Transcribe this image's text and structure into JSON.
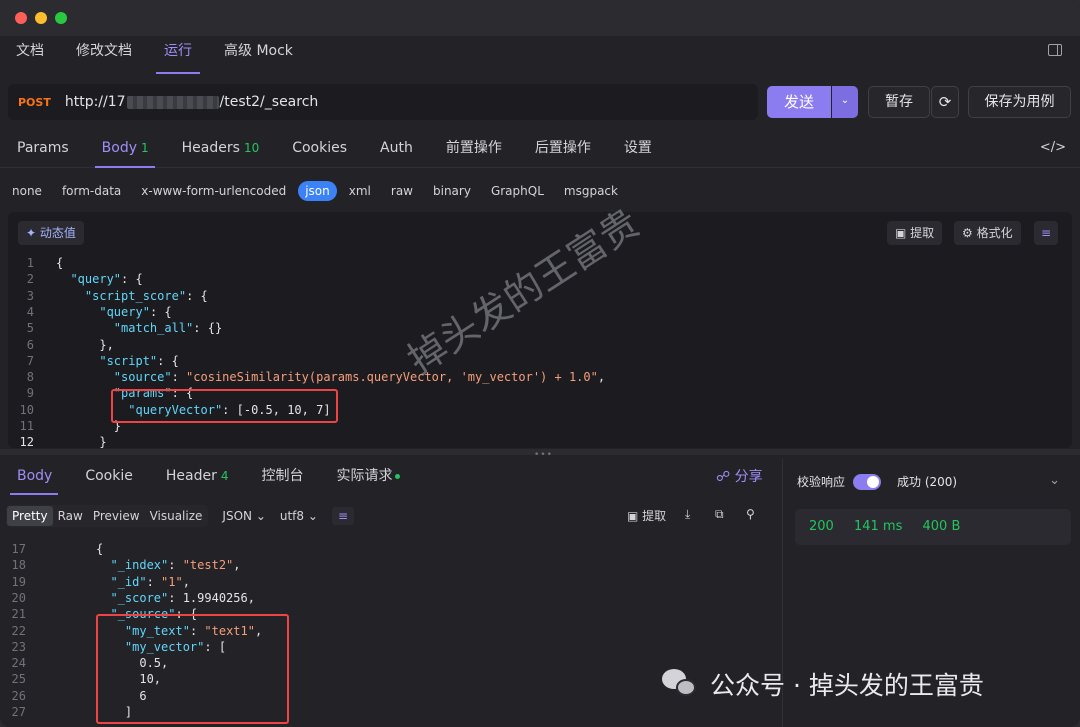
{
  "top_tabs": [
    {
      "label": "文档"
    },
    {
      "label": "修改文档"
    },
    {
      "label": "运行"
    },
    {
      "label": "高级 Mock"
    }
  ],
  "request": {
    "method": "POST",
    "url_prefix": "http://17",
    "url_suffix": "/test2/_search",
    "send_label": "发送",
    "save_temp_label": "暂存",
    "save_case_label": "保存为用例"
  },
  "request_tabs": [
    {
      "label": "Params",
      "count": ""
    },
    {
      "label": "Body",
      "count": "1"
    },
    {
      "label": "Headers",
      "count": "10"
    },
    {
      "label": "Cookies",
      "count": ""
    },
    {
      "label": "Auth",
      "count": ""
    },
    {
      "label": "前置操作",
      "count": ""
    },
    {
      "label": "后置操作",
      "count": ""
    },
    {
      "label": "设置",
      "count": ""
    }
  ],
  "code_toggle_icon": "</>",
  "body_types": [
    "none",
    "form-data",
    "x-www-form-urlencoded",
    "json",
    "xml",
    "raw",
    "binary",
    "GraphQL",
    "msgpack"
  ],
  "editor": {
    "dynamic_label": "动态值",
    "extract_label": "提取",
    "format_label": "格式化",
    "lines": [
      {
        "no": "1",
        "code": "{"
      },
      {
        "no": "2",
        "code": "  \"query\": {"
      },
      {
        "no": "3",
        "code": "    \"script_score\": {"
      },
      {
        "no": "4",
        "code": "      \"query\": {"
      },
      {
        "no": "5",
        "code": "        \"match_all\": {}"
      },
      {
        "no": "6",
        "code": "      },"
      },
      {
        "no": "7",
        "code": "      \"script\": {"
      },
      {
        "no": "8",
        "code": "        \"source\": \"cosineSimilarity(params.queryVector, 'my_vector') + 1.0\","
      },
      {
        "no": "9",
        "code": "        \"params\": {"
      },
      {
        "no": "10",
        "code": "          \"queryVector\": [-0.5, 10, 7]"
      },
      {
        "no": "11",
        "code": "        }"
      },
      {
        "no": "12",
        "code": "      }"
      }
    ]
  },
  "watermark": "掉头发的王富贵",
  "response_tabs": [
    {
      "label": "Body",
      "count": ""
    },
    {
      "label": "Cookie",
      "count": ""
    },
    {
      "label": "Header",
      "count": "4"
    },
    {
      "label": "控制台",
      "count": ""
    },
    {
      "label": "实际请求",
      "count": ""
    }
  ],
  "share_label": "分享",
  "view_modes": [
    "Pretty",
    "Raw",
    "Preview",
    "Visualize"
  ],
  "format_select": "JSON",
  "encoding_select": "utf8",
  "response_extract_label": "提取",
  "response_lines": [
    {
      "no": "17",
      "code": "{"
    },
    {
      "no": "18",
      "code": "  \"_index\": \"test2\","
    },
    {
      "no": "19",
      "code": "  \"_id\": \"1\","
    },
    {
      "no": "20",
      "code": "  \"_score\": 1.9940256,"
    },
    {
      "no": "21",
      "code": "  \"_source\": {"
    },
    {
      "no": "22",
      "code": "    \"my_text\": \"text1\","
    },
    {
      "no": "23",
      "code": "    \"my_vector\": ["
    },
    {
      "no": "24",
      "code": "      0.5,"
    },
    {
      "no": "25",
      "code": "      10,"
    },
    {
      "no": "26",
      "code": "      6"
    },
    {
      "no": "27",
      "code": "    ]"
    }
  ],
  "right_panel": {
    "verify_label": "校验响应",
    "result_label": "成功 (200)",
    "status_code": "200",
    "time": "141 ms",
    "size": "400 B"
  },
  "footer_watermark": "公众号 · 掉头发的王富贵"
}
